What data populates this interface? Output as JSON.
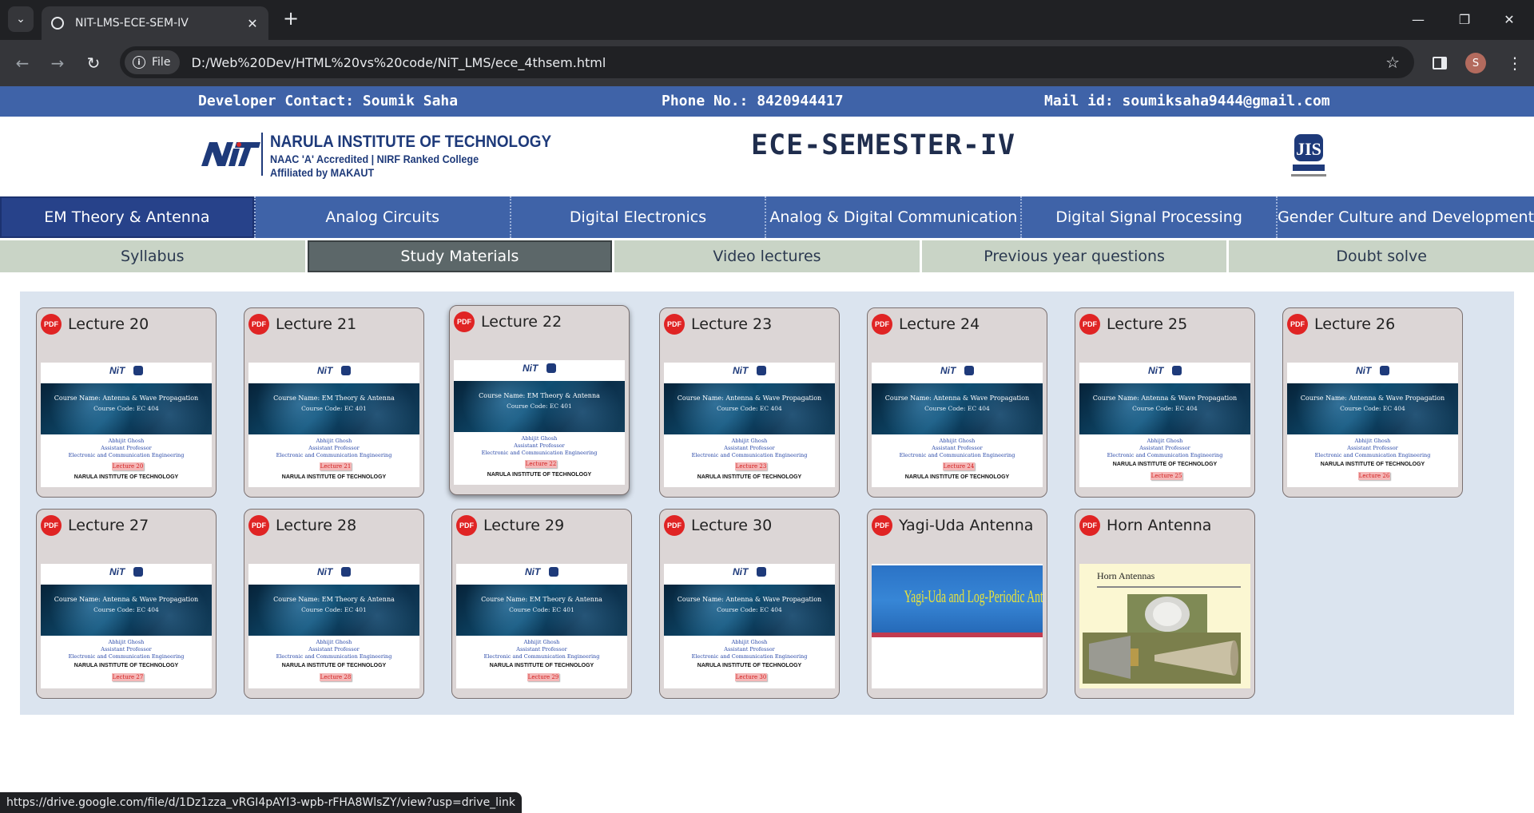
{
  "browser": {
    "tab_title": "NIT-LMS-ECE-SEM-IV",
    "new_tab": "+",
    "chip_label": "File",
    "url": "D:/Web%20Dev/HTML%20vs%20code/NiT_LMS/ece_4thsem.html",
    "avatar_letter": "S",
    "status_url": "https://drive.google.com/file/d/1Dz1zza_vRGI4pAYI3-wpb-rFHA8WlsZY/view?usp=drive_link"
  },
  "contact": {
    "developer": "Developer Contact: Soumik Saha",
    "phone": "Phone No.: 8420944417",
    "mail": "Mail id: soumiksaha9444@gmail.com"
  },
  "header": {
    "nit_name": "NARULA INSTITUTE OF TECHNOLOGY",
    "nit_accreditation": "NAAC 'A' Accredited | NIRF Ranked College",
    "nit_affiliation": "Affiliated by MAKAUT",
    "title": "ECE-SEMESTER-IV"
  },
  "subjects": [
    {
      "label": "EM Theory & Antenna",
      "active": true
    },
    {
      "label": "Analog Circuits",
      "active": false
    },
    {
      "label": "Digital Electronics",
      "active": false
    },
    {
      "label": "Analog & Digital Communication",
      "active": false
    },
    {
      "label": "Digital Signal Processing",
      "active": false
    },
    {
      "label": "Gender Culture and Development",
      "active": false
    }
  ],
  "sections": [
    {
      "label": "Syllabus",
      "active": false
    },
    {
      "label": "Study Materials",
      "active": true
    },
    {
      "label": "Video lectures",
      "active": false
    },
    {
      "label": "Previous year questions",
      "active": false
    },
    {
      "label": "Doubt solve",
      "active": false
    }
  ],
  "thumb_common": {
    "author": "Abhijit Ghosh",
    "designation": "Assistant Professor",
    "department": "Electronic and Communication Engineering",
    "institute": "NARULA INSTITUTE OF TECHNOLOGY"
  },
  "materials": [
    {
      "title": "Lecture 20",
      "course": "Course Name: Antenna & Wave Propagation",
      "code": "Course Code: EC 404",
      "tag": "Lecture 20"
    },
    {
      "title": "Lecture 21",
      "course": "Course Name: EM Theory & Antenna",
      "code": "Course Code: EC 401",
      "tag": "Lecture 21"
    },
    {
      "title": "Lecture 22",
      "course": "Course Name: EM Theory & Antenna",
      "code": "Course Code: EC 401",
      "tag": "Lecture 22"
    },
    {
      "title": "Lecture 23",
      "course": "Course Name: Antenna & Wave Propagation",
      "code": "Course Code: EC 404",
      "tag": "Lecture 23"
    },
    {
      "title": "Lecture 24",
      "course": "Course Name: Antenna & Wave Propagation",
      "code": "Course Code: EC 404",
      "tag": "Lecture 24"
    },
    {
      "title": "Lecture 25",
      "course": "Course Name: Antenna & Wave Propagation",
      "code": "Course Code: EC 404",
      "tag": "Lecture 25"
    },
    {
      "title": "Lecture 26",
      "course": "Course Name: Antenna & Wave Propagation",
      "code": "Course Code: EC 404",
      "tag": "Lecture 26"
    },
    {
      "title": "Lecture 27",
      "course": "Course Name: Antenna & Wave Propagation",
      "code": "Course Code: EC 404",
      "tag": "Lecture 27"
    },
    {
      "title": "Lecture 28",
      "course": "Course Name: EM Theory & Antenna",
      "code": "Course Code: EC 401",
      "tag": "Lecture 28"
    },
    {
      "title": "Lecture 29",
      "course": "Course Name: EM Theory & Antenna",
      "code": "Course Code: EC 401",
      "tag": "Lecture 29"
    },
    {
      "title": "Lecture 30",
      "course": "Course Name: Antenna & Wave Propagation",
      "code": "Course Code: EC 404",
      "tag": "Lecture 30"
    },
    {
      "title": "Yagi-Uda Antenna",
      "slide_text": "Yagi-Uda and Log-Periodic Antennas"
    },
    {
      "title": "Horn Antenna",
      "slide_text": "Horn Antennas"
    }
  ],
  "icons": {
    "pdf": "PDF"
  }
}
